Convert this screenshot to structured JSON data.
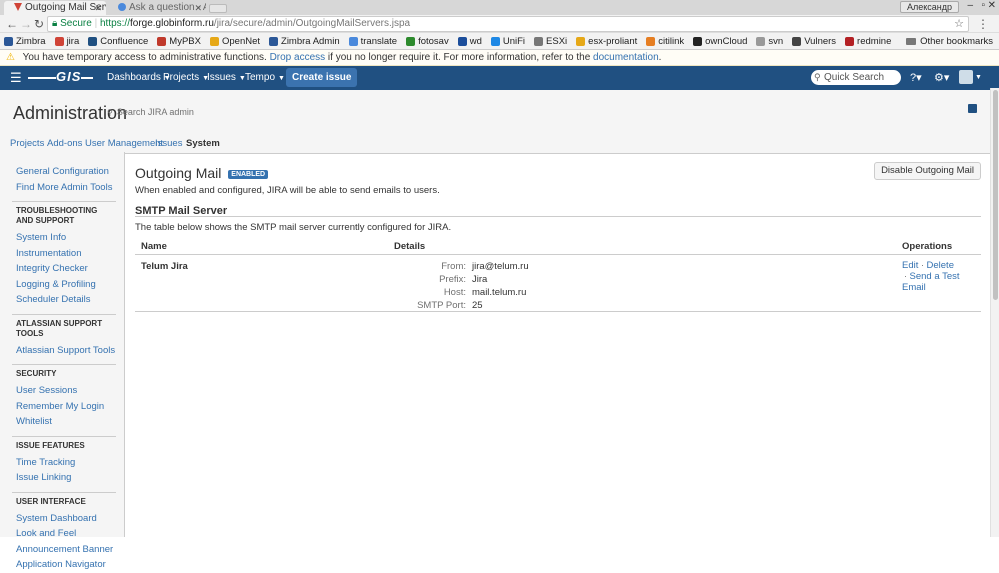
{
  "browser": {
    "tabs": [
      {
        "label": "Outgoing Mail Serv",
        "active": true
      },
      {
        "label": "Ask a question - At",
        "active": false
      }
    ],
    "profile_label": "Александр",
    "url_secure_label": "Secure",
    "url_scheme": "https://",
    "url_host": "forge.globinform.ru",
    "url_path": "/jira/secure/admin/OutgoingMailServers.jspa",
    "bookmarks": [
      {
        "label": "Zimbra",
        "color": "#2b5797"
      },
      {
        "label": "jira",
        "color": "#d04437"
      },
      {
        "label": "Confluence",
        "color": "#205081"
      },
      {
        "label": "MyPBX",
        "color": "#c0392b"
      },
      {
        "label": "OpenNet",
        "color": "#e6a817"
      },
      {
        "label": "Zimbra Admin",
        "color": "#2b5797"
      },
      {
        "label": "translate",
        "color": "#4a89dc"
      },
      {
        "label": "fotosav",
        "color": "#2d8a2d"
      },
      {
        "label": "wd",
        "color": "#1c4e9b"
      },
      {
        "label": "UniFi",
        "color": "#1e88e5"
      },
      {
        "label": "ESXi",
        "color": "#777777"
      },
      {
        "label": "esx-proliant",
        "color": "#e6a817"
      },
      {
        "label": "citilink",
        "color": "#e67e22"
      },
      {
        "label": "ownCloud",
        "color": "#222222"
      },
      {
        "label": "svn",
        "color": "#999999"
      },
      {
        "label": "Vulners",
        "color": "#444444"
      },
      {
        "label": "redmine",
        "color": "#b32024"
      }
    ],
    "other_bookmarks": "Other bookmarks"
  },
  "warning": {
    "text_before": "You have temporary access to administrative functions.",
    "link1": "Drop access",
    "text_middle": "if you no longer require it. For more information, refer to the",
    "link2": "documentation",
    "text_after": "."
  },
  "header": {
    "logo_text": "GIS",
    "menus": [
      "Dashboards",
      "Projects",
      "Issues",
      "Tempo"
    ],
    "create_label": "Create issue",
    "search_placeholder": "Quick Search"
  },
  "admin": {
    "title": "Administration",
    "search_placeholder": "Search JIRA admin",
    "tabs": [
      "Projects",
      "Add-ons",
      "User Management",
      "Issues",
      "System"
    ],
    "current_tab": "System"
  },
  "sidebar": {
    "top_links": [
      "General Configuration",
      "Find More Admin Tools"
    ],
    "sections": [
      {
        "heading": "TROUBLESHOOTING AND SUPPORT",
        "links": [
          "System Info",
          "Instrumentation",
          "Integrity Checker",
          "Logging & Profiling",
          "Scheduler Details"
        ]
      },
      {
        "heading": "ATLASSIAN SUPPORT TOOLS",
        "links": [
          "Atlassian Support Tools"
        ]
      },
      {
        "heading": "SECURITY",
        "links": [
          "User Sessions",
          "Remember My Login",
          "Whitelist"
        ]
      },
      {
        "heading": "ISSUE FEATURES",
        "links": [
          "Time Tracking",
          "Issue Linking"
        ]
      },
      {
        "heading": "USER INTERFACE",
        "links": [
          "System Dashboard",
          "Look and Feel",
          "Announcement Banner",
          "Application Navigator"
        ]
      }
    ]
  },
  "content": {
    "title": "Outgoing Mail",
    "badge": "ENABLED",
    "disable_button": "Disable Outgoing Mail",
    "description": "When enabled and configured, JIRA will be able to send emails to users.",
    "smtp_heading": "SMTP Mail Server",
    "smtp_description": "The table below shows the SMTP mail server currently configured for JIRA.",
    "table": {
      "headers": {
        "name": "Name",
        "details": "Details",
        "operations": "Operations"
      },
      "row": {
        "name": "Telum Jira",
        "details": [
          {
            "label": "From:",
            "value": "jira@telum.ru"
          },
          {
            "label": "Prefix:",
            "value": "Jira"
          },
          {
            "label": "Host:",
            "value": "mail.telum.ru"
          },
          {
            "label": "SMTP Port:",
            "value": "25"
          }
        ],
        "operations": {
          "edit": "Edit",
          "delete": "Delete",
          "test": "Send a Test Email"
        }
      }
    }
  }
}
